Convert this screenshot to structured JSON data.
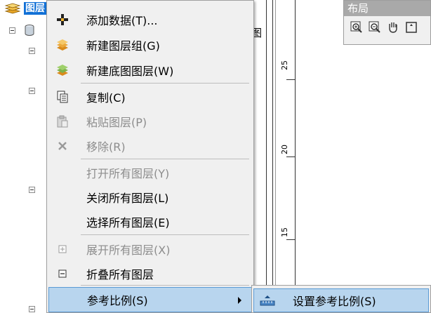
{
  "toc": {
    "root_label": "图层"
  },
  "background": {
    "partial_text": "图",
    "ruler_labels": [
      "25",
      "20",
      "15"
    ]
  },
  "layout_toolbar": {
    "title": "布局",
    "icons": [
      "zoom-in-icon",
      "zoom-out-icon",
      "pan-hand-icon",
      "full-extent-icon"
    ]
  },
  "context_menu": {
    "items": [
      {
        "label": "添加数据(T)...",
        "icon": "add-data-icon",
        "enabled": true
      },
      {
        "label": "新建图层组(G)",
        "icon": "new-group-layer-icon",
        "enabled": true
      },
      {
        "label": "新建底图图层(W)",
        "icon": "new-basemap-layer-icon",
        "enabled": true
      },
      {
        "label": "复制(C)",
        "icon": "copy-icon",
        "enabled": true
      },
      {
        "label": "粘贴图层(P)",
        "icon": "paste-icon",
        "enabled": false
      },
      {
        "label": "移除(R)",
        "icon": "remove-icon",
        "enabled": false
      },
      {
        "label": "打开所有图层(Y)",
        "icon": "",
        "enabled": false
      },
      {
        "label": "关闭所有图层(L)",
        "icon": "",
        "enabled": true
      },
      {
        "label": "选择所有图层(E)",
        "icon": "",
        "enabled": true
      },
      {
        "label": "展开所有图层(X)",
        "icon": "expand-icon",
        "enabled": false
      },
      {
        "label": "折叠所有图层",
        "icon": "collapse-icon",
        "enabled": true
      },
      {
        "label": "参考比例(S)",
        "icon": "",
        "enabled": true,
        "has_submenu": true
      }
    ]
  },
  "submenu": {
    "items": [
      {
        "label": "设置参考比例(S)",
        "icon": "set-reference-scale-icon"
      }
    ]
  },
  "colors": {
    "menu_bg": "#f0f0f0",
    "highlight_bg": "#b8d5ee",
    "highlight_border": "#5b9bd5",
    "disabled_text": "#8d8d8d",
    "selection_blue": "#1170d6"
  }
}
